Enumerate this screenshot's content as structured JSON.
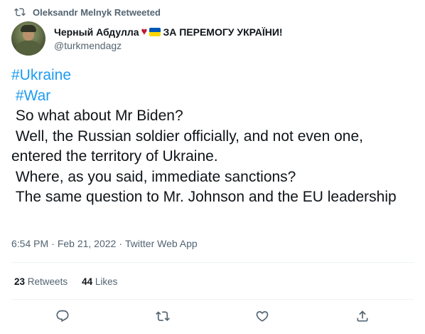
{
  "retweet_bar": {
    "label": "Oleksandr Melnyk Retweeted",
    "icon": "retweet-icon"
  },
  "author": {
    "display_name": "Черный Абдулла",
    "heart": "♥",
    "slogan": "ЗА ПЕРЕМОГУ УКРАЇНИ!",
    "handle": "@turkmendagz"
  },
  "tweet": {
    "hashtag1": "#Ukraine",
    "hashtag2": "#War",
    "line1": " So what about Mr Biden?",
    "line2": " Well, the Russian soldier officially, and not even one, entered the territory of Ukraine.",
    "line3": " Where, as you said, immediate sanctions?",
    "line4": " The same question to Mr. Johnson and the EU leadership"
  },
  "meta": {
    "time": "6:54 PM",
    "sep1": "·",
    "date": "Feb 21, 2022",
    "sep2": "·",
    "source": "Twitter Web App"
  },
  "stats": {
    "retweets_count": "23",
    "retweets_label": "Retweets",
    "likes_count": "44",
    "likes_label": "Likes"
  },
  "actions": [
    "reply-icon",
    "retweet-icon",
    "like-icon",
    "share-icon"
  ],
  "colors": {
    "link": "#1d9bf0",
    "secondary": "#536471",
    "text": "#0f1419",
    "divider": "#eff3f4"
  }
}
